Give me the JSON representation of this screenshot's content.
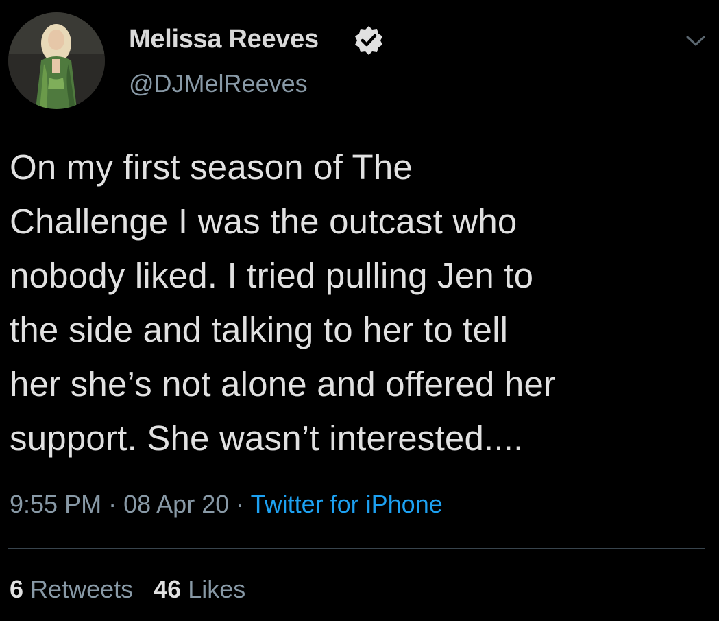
{
  "user": {
    "name": "Melissa Reeves",
    "handle": "@DJMelReeves",
    "verified": true
  },
  "tweet": {
    "lines": [
      "On my first season of The",
      "Challenge I was the outcast who",
      "nobody liked. I tried pulling Jen to",
      "the side and talking to her to tell",
      "her she’s not alone and offered her",
      "support. She wasn’t interested...."
    ]
  },
  "meta": {
    "time": "9:55 PM",
    "separator": "·",
    "date": "08 Apr 20",
    "source": "Twitter for iPhone"
  },
  "stats": {
    "retweets_count": "6",
    "retweets_label": "Retweets",
    "likes_count": "46",
    "likes_label": "Likes"
  },
  "colors": {
    "background": "#000000",
    "text": "#e1e1e1",
    "secondary_text": "#8899a6",
    "link": "#1da1f2",
    "divider": "#38444d"
  },
  "icons": {
    "verified": "verified-badge-icon",
    "menu": "chevron-down-icon"
  }
}
